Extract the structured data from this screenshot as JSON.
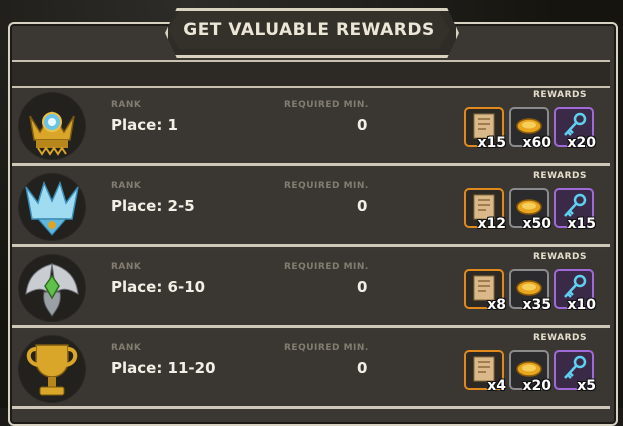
{
  "title": "GET VALUABLE REWARDS",
  "labels": {
    "rank": "RANK",
    "required": "REQUIRED MIN.",
    "rewards": "REWARDS"
  },
  "rows": [
    {
      "place": "Place: 1",
      "required": "0",
      "emblem": "gold-crown-blue-gem-icon",
      "rewards": {
        "scroll": "x15",
        "coin": "x60",
        "key": "x20"
      }
    },
    {
      "place": "Place: 2-5",
      "required": "0",
      "emblem": "ice-crystal-crown-icon",
      "rewards": {
        "scroll": "x12",
        "coin": "x50",
        "key": "x15"
      }
    },
    {
      "place": "Place: 6-10",
      "required": "0",
      "emblem": "silver-winged-green-gem-icon",
      "rewards": {
        "scroll": "x8",
        "coin": "x35",
        "key": "x10"
      }
    },
    {
      "place": "Place: 11-20",
      "required": "0",
      "emblem": "gold-trophy-icon",
      "rewards": {
        "scroll": "x4",
        "coin": "x20",
        "key": "x5"
      }
    }
  ],
  "colors": {
    "scroll_border": "#e08a1e",
    "coin_border": "#8b8b8d",
    "key_border": "#a06bd8"
  }
}
